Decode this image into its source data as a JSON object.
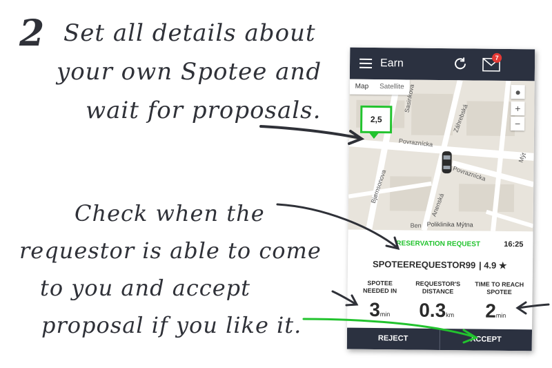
{
  "annotations": {
    "step_number": "2",
    "step_lines": [
      "Set all details about",
      "your own Spotee and",
      "wait for proposals."
    ],
    "check_lines": [
      "Check when the",
      "requestor is able to come",
      "to you and accept",
      "proposal if you like it."
    ]
  },
  "app": {
    "title": "Earn",
    "mail_badge": "7",
    "map": {
      "tab_map": "Map",
      "tab_satellite": "Satellite",
      "zoom_in": "+",
      "zoom_out": "−",
      "price_pin": "2,5",
      "streets": [
        "Povraznícka",
        "Povraznícka",
        "Bjørnsonova",
        "Záhrebská",
        "Anenská",
        "Sasinkova",
        "Ben",
        "Mýt"
      ],
      "poi": "Poliklinika Mýtna"
    },
    "reservation": {
      "label": "RESERVATION REQUEST",
      "time": "16:25",
      "requestor": "SPOTEEREQUESTOR99",
      "rating": "| 4.9 ★",
      "stats": [
        {
          "label": "SPOTEE NEEDED IN",
          "value": "3",
          "unit": "min"
        },
        {
          "label": "REQUESTOR'S DISTANCE",
          "value": "0.3",
          "unit": "km"
        },
        {
          "label": "TIME TO REACH SPOTEE",
          "value": "2",
          "unit": "min"
        }
      ]
    },
    "actions": {
      "reject": "REJECT",
      "accept": "ACCEPT"
    }
  },
  "colors": {
    "topbar": "#2b3140",
    "accent_green": "#22c32e",
    "badge_red": "#e53935"
  }
}
